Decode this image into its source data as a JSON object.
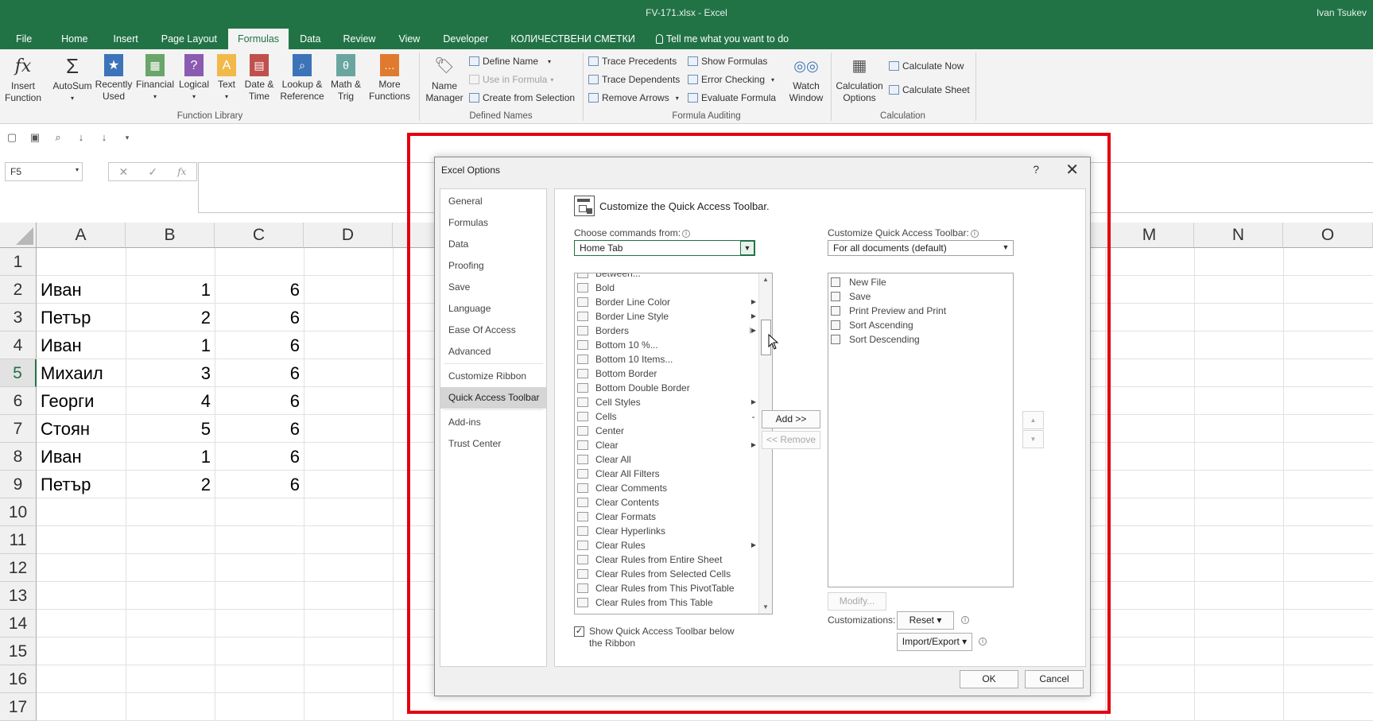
{
  "window": {
    "title": "FV-171.xlsx - Excel",
    "user": "Ivan Tsukev"
  },
  "tabs": [
    {
      "label": "File"
    },
    {
      "label": "Home"
    },
    {
      "label": "Insert"
    },
    {
      "label": "Page Layout"
    },
    {
      "label": "Formulas"
    },
    {
      "label": "Data"
    },
    {
      "label": "Review"
    },
    {
      "label": "View"
    },
    {
      "label": "Developer"
    },
    {
      "label": "КОЛИЧЕСТВЕНИ СМЕТКИ"
    },
    {
      "label": "Tell me what you want to do"
    }
  ],
  "ribbon": {
    "insert_function": {
      "line1": "Insert",
      "line2": "Function"
    },
    "autosum": {
      "line1": "AutoSum",
      "line2": ""
    },
    "recently_used": {
      "line1": "Recently",
      "line2": "Used"
    },
    "financial": {
      "line1": "Financial",
      "line2": ""
    },
    "logical": {
      "line1": "Logical",
      "line2": ""
    },
    "text": {
      "line1": "Text",
      "line2": ""
    },
    "date_time": {
      "line1": "Date &",
      "line2": "Time"
    },
    "lookup": {
      "line1": "Lookup &",
      "line2": "Reference"
    },
    "math": {
      "line1": "Math &",
      "line2": "Trig"
    },
    "more": {
      "line1": "More",
      "line2": "Functions"
    },
    "name_manager": {
      "line1": "Name",
      "line2": "Manager"
    },
    "define_name": "Define Name",
    "use_in_formula": "Use in Formula",
    "create_from_selection": "Create from Selection",
    "trace_precedents": "Trace Precedents",
    "trace_dependents": "Trace Dependents",
    "remove_arrows": "Remove Arrows",
    "show_formulas": "Show Formulas",
    "error_checking": "Error Checking",
    "evaluate_formula": "Evaluate Formula",
    "watch_window": {
      "line1": "Watch",
      "line2": "Window"
    },
    "calc_options": {
      "line1": "Calculation",
      "line2": "Options"
    },
    "calculate_now": "Calculate Now",
    "calculate_sheet": "Calculate Sheet",
    "groups": {
      "function_library": "Function Library",
      "defined_names": "Defined Names",
      "formula_auditing": "Formula Auditing",
      "calculation": "Calculation"
    }
  },
  "formula_bar": {
    "name_box": "F5",
    "fx": "fx"
  },
  "sheet": {
    "columns": [
      "A",
      "B",
      "C",
      "D",
      "M",
      "N",
      "O"
    ],
    "rows": [
      "1",
      "2",
      "3",
      "4",
      "5",
      "6",
      "7",
      "8",
      "9",
      "10",
      "11",
      "12",
      "13",
      "14",
      "15",
      "16",
      "17"
    ],
    "selected_row": "5",
    "cells": [
      {
        "a": "",
        "b": "",
        "c": ""
      },
      {
        "a": "Иван",
        "b": "1",
        "c": "6"
      },
      {
        "a": "Петър",
        "b": "2",
        "c": "6"
      },
      {
        "a": "Иван",
        "b": "1",
        "c": "6"
      },
      {
        "a": "Михаил",
        "b": "3",
        "c": "6"
      },
      {
        "a": "Георги",
        "b": "4",
        "c": "6"
      },
      {
        "a": "Стоян",
        "b": "5",
        "c": "6"
      },
      {
        "a": "Иван",
        "b": "1",
        "c": "6"
      },
      {
        "a": "Петър",
        "b": "2",
        "c": "6"
      }
    ]
  },
  "dialog": {
    "title": "Excel Options",
    "help": "?",
    "close": "✕",
    "nav": [
      {
        "label": "General"
      },
      {
        "label": "Formulas"
      },
      {
        "label": "Data"
      },
      {
        "label": "Proofing"
      },
      {
        "label": "Save"
      },
      {
        "label": "Language"
      },
      {
        "label": "Ease Of Access"
      },
      {
        "label": "Advanced"
      },
      {
        "label": "Customize Ribbon"
      },
      {
        "label": "Quick Access Toolbar"
      },
      {
        "label": "Add-ins"
      },
      {
        "label": "Trust Center"
      }
    ],
    "heading": "Customize the Quick Access Toolbar.",
    "choose_label": "Choose commands from:",
    "choose_value": "Home Tab",
    "customize_label": "Customize Quick Access Toolbar:",
    "customize_value": "For all documents (default)",
    "commands": [
      {
        "label": "Between...",
        "sub": ""
      },
      {
        "label": "Bold",
        "sub": ""
      },
      {
        "label": "Border Line Color",
        "sub": "▶"
      },
      {
        "label": "Border Line Style",
        "sub": "▶"
      },
      {
        "label": "Borders",
        "sub": "|▶"
      },
      {
        "label": "Bottom 10 %...",
        "sub": ""
      },
      {
        "label": "Bottom 10 Items...",
        "sub": ""
      },
      {
        "label": "Bottom Border",
        "sub": ""
      },
      {
        "label": "Bottom Double Border",
        "sub": ""
      },
      {
        "label": "Cell Styles",
        "sub": "▶"
      },
      {
        "label": "Cells",
        "sub": "⌄"
      },
      {
        "label": "Center",
        "sub": ""
      },
      {
        "label": "Clear",
        "sub": "▶"
      },
      {
        "label": "Clear All",
        "sub": ""
      },
      {
        "label": "Clear All Filters",
        "sub": ""
      },
      {
        "label": "Clear Comments",
        "sub": ""
      },
      {
        "label": "Clear Contents",
        "sub": ""
      },
      {
        "label": "Clear Formats",
        "sub": ""
      },
      {
        "label": "Clear Hyperlinks",
        "sub": ""
      },
      {
        "label": "Clear Rules",
        "sub": "▶"
      },
      {
        "label": "Clear Rules from Entire Sheet",
        "sub": ""
      },
      {
        "label": "Clear Rules from Selected Cells",
        "sub": ""
      },
      {
        "label": "Clear Rules from This PivotTable",
        "sub": ""
      },
      {
        "label": "Clear Rules from This Table",
        "sub": ""
      }
    ],
    "qat_items": [
      {
        "label": "New File"
      },
      {
        "label": "Save"
      },
      {
        "label": "Print Preview and Print"
      },
      {
        "label": "Sort Ascending"
      },
      {
        "label": "Sort Descending"
      }
    ],
    "add_button": "Add >>",
    "remove_button": "<< Remove",
    "modify_button": "Modify...",
    "customizations_label": "Customizations:",
    "reset_button": "Reset ▾",
    "import_export_button": "Import/Export ▾",
    "show_below_label": "Show Quick Access Toolbar below the Ribbon",
    "ok_button": "OK",
    "cancel_button": "Cancel"
  },
  "colors": {
    "excel_green": "#217346",
    "annotation_red": "#e3000f"
  }
}
